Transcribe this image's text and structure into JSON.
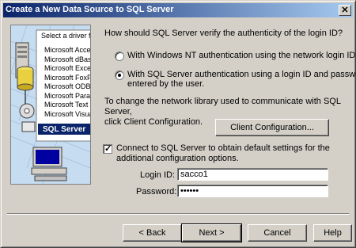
{
  "window": {
    "title": "Create a New Data Source to SQL Server",
    "close_glyph": "✕"
  },
  "illustration": {
    "list_header": "Select a driver for",
    "driver_items": [
      "Microsoft Access D",
      "Microsoft dBase D",
      "Microsoft Excel D",
      "Microsoft FoxPro",
      "Microsoft ODBC",
      "Microsoft Paradox",
      "Microsoft Text",
      "Microsoft Visual"
    ],
    "selected_item": "SQL Server"
  },
  "auth": {
    "question": "How should SQL Server verify the authenticity of the login ID?",
    "option_nt_label": "With Windows NT authentication using the network login ID.",
    "option_sql_label_line1": "With SQL Server authentication using a login ID and password",
    "option_sql_label_line2": "entered by the user.",
    "selected": "sql"
  },
  "network": {
    "info_line1": "To change the network library used to communicate with SQL Server,",
    "info_line2": "click Client Configuration.",
    "client_config_button": "Client Configuration..."
  },
  "connect": {
    "checkbox_label_line1": "Connect to SQL Server to obtain default settings for the",
    "checkbox_label_line2": "additional configuration options.",
    "checked": true
  },
  "login": {
    "login_id_label": "Login ID:",
    "login_id_value": "sacco1",
    "password_label": "Password:",
    "password_value": "••••••"
  },
  "buttons": {
    "back": "< Back",
    "next": "Next >",
    "cancel": "Cancel",
    "help": "Help"
  }
}
